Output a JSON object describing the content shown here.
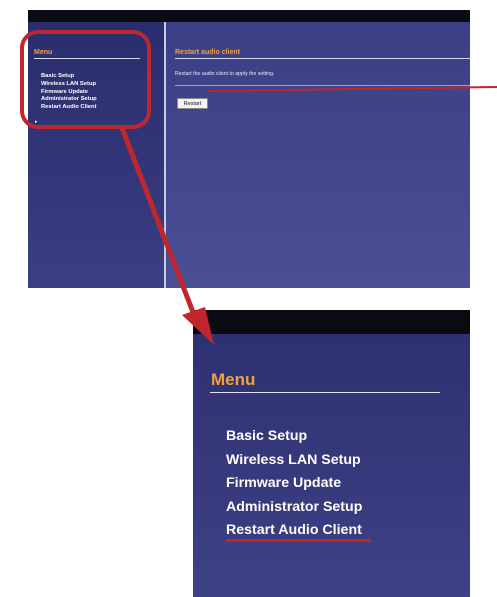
{
  "sidebar": {
    "heading": "Menu",
    "items": [
      {
        "label": "Basic Setup"
      },
      {
        "label": "Wireless LAN Setup"
      },
      {
        "label": "Firmware Update"
      },
      {
        "label": "Administrator Setup"
      },
      {
        "label": "Restart Audio Client"
      }
    ],
    "active_index": 4
  },
  "main": {
    "title": "Restart audio client",
    "description": "Restart the audio client to apply the setting.",
    "restart_button_label": "Restart"
  },
  "colors": {
    "heading_orange": "#f0a040",
    "panel_navy": "#3b3f86",
    "annotation_red": "#c0272d"
  }
}
